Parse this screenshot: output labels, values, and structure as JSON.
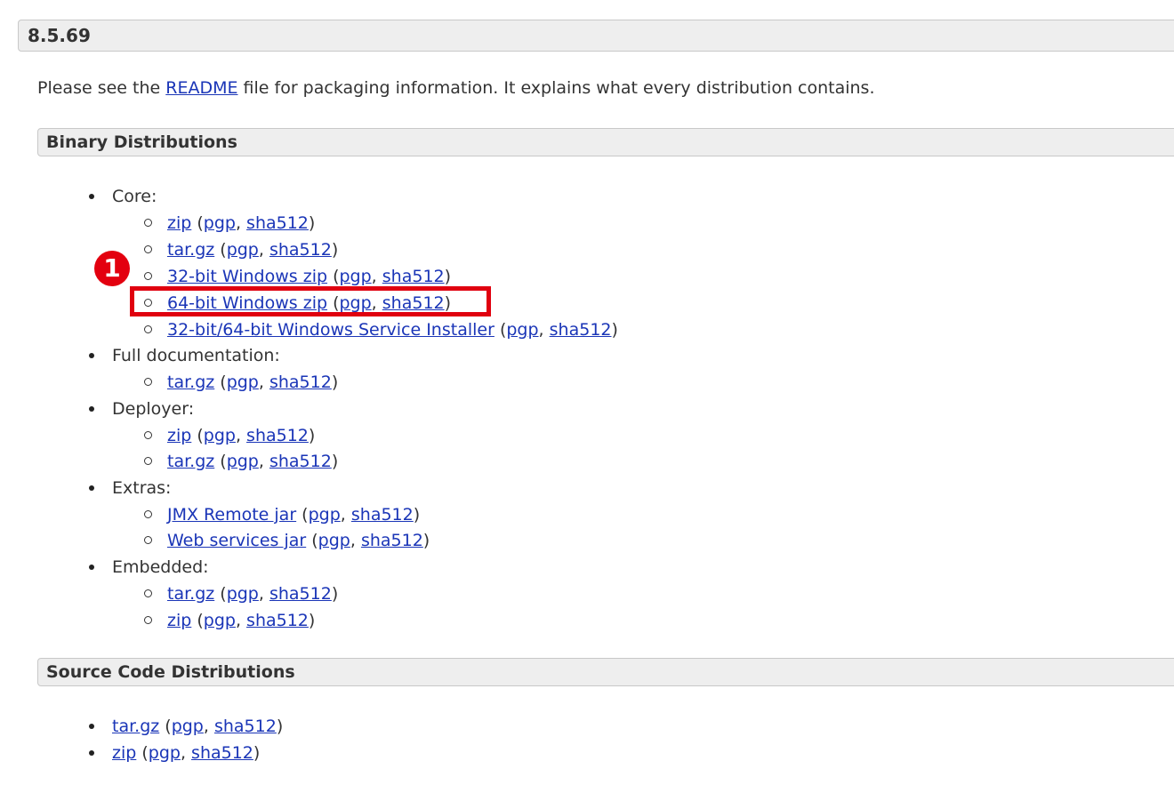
{
  "version": "8.5.69",
  "intro": {
    "before": "Please see the ",
    "link": "README",
    "after": " file for packaging information. It explains what every distribution contains."
  },
  "binary_title": "Binary Distributions",
  "source_title": "Source Code Distributions",
  "annotation": {
    "step": "1",
    "color": "#e3000f"
  },
  "link_color": "#1a35b7",
  "core": {
    "label": "Core:",
    "items": [
      {
        "link": "zip",
        "pgp": "pgp",
        "sha": "sha512"
      },
      {
        "link": "tar.gz",
        "pgp": "pgp",
        "sha": "sha512"
      },
      {
        "link": "32-bit Windows zip",
        "pgp": "pgp",
        "sha": "sha512"
      },
      {
        "link": "64-bit Windows zip",
        "pgp": "pgp",
        "sha": "sha512"
      },
      {
        "link": "32-bit/64-bit Windows Service Installer",
        "pgp": "pgp",
        "sha": "sha512"
      }
    ]
  },
  "fulldoc": {
    "label": "Full documentation:",
    "items": [
      {
        "link": "tar.gz",
        "pgp": "pgp",
        "sha": "sha512"
      }
    ]
  },
  "deployer": {
    "label": "Deployer:",
    "items": [
      {
        "link": "zip",
        "pgp": "pgp",
        "sha": "sha512"
      },
      {
        "link": "tar.gz",
        "pgp": "pgp",
        "sha": "sha512"
      }
    ]
  },
  "extras": {
    "label": "Extras:",
    "items": [
      {
        "link": "JMX Remote jar",
        "pgp": "pgp",
        "sha": "sha512"
      },
      {
        "link": "Web services jar",
        "pgp": "pgp",
        "sha": "sha512"
      }
    ]
  },
  "embedded": {
    "label": "Embedded:",
    "items": [
      {
        "link": "tar.gz",
        "pgp": "pgp",
        "sha": "sha512"
      },
      {
        "link": "zip",
        "pgp": "pgp",
        "sha": "sha512"
      }
    ]
  },
  "source": {
    "items": [
      {
        "link": "tar.gz",
        "pgp": "pgp",
        "sha": "sha512"
      },
      {
        "link": "zip",
        "pgp": "pgp",
        "sha": "sha512"
      }
    ]
  }
}
